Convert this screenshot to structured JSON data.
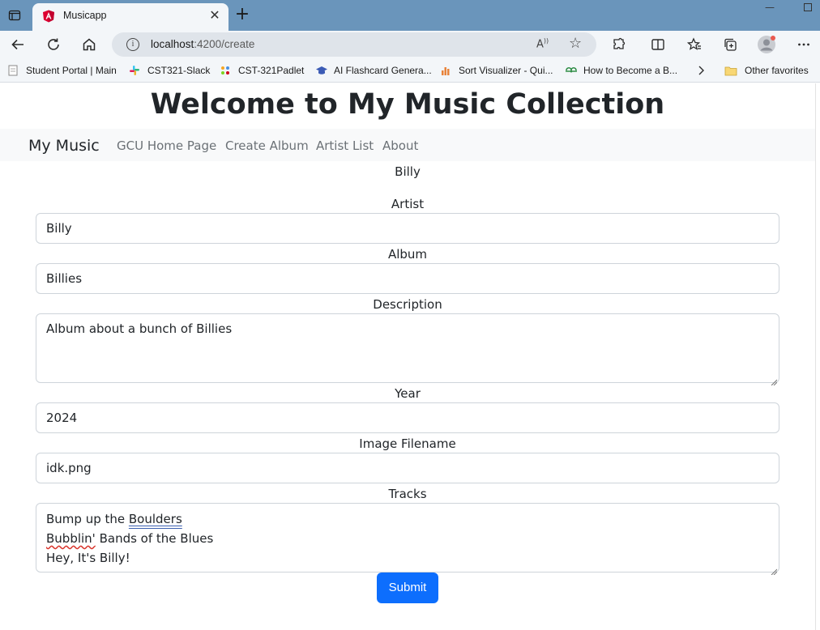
{
  "browser": {
    "tab_title": "Musicapp",
    "url_host": "localhost",
    "url_path": ":4200/create",
    "read_aloud_icon": "read-aloud-icon",
    "bookmarks": [
      {
        "label": "Student Portal | Main",
        "icon": "page-icon"
      },
      {
        "label": "CST321-Slack",
        "icon": "slack-icon"
      },
      {
        "label": "CST-321Padlet",
        "icon": "padlet-icon"
      },
      {
        "label": "AI Flashcard Genera...",
        "icon": "graduation-cap-icon"
      },
      {
        "label": "Sort Visualizer - Qui...",
        "icon": "bar-chart-icon"
      },
      {
        "label": "How to Become a B...",
        "icon": "gfg-icon"
      },
      {
        "label": "Other favorites",
        "icon": "folder-icon"
      }
    ]
  },
  "page": {
    "heading": "Welcome to My Music Collection",
    "nav": {
      "brand": "My Music",
      "links": [
        "GCU Home Page",
        "Create Album",
        "Artist List",
        "About"
      ]
    },
    "preview_artist": "Billy",
    "form": {
      "artist_label": "Artist",
      "artist_value": "Billy",
      "album_label": "Album",
      "album_value": "Billies",
      "description_label": "Description",
      "description_value": "Album about a bunch of Billies",
      "year_label": "Year",
      "year_value": "2024",
      "image_label": "Image Filename",
      "image_value": "idk.png",
      "tracks_label": "Tracks",
      "tracks": {
        "line1_prefix": "Bump up the ",
        "line1_word": "Boulders",
        "line2_word": "Bubblin'",
        "line2_rest": " Bands of the Blues",
        "line3": "Hey, It's Billy!"
      },
      "submit_label": "Submit"
    }
  },
  "colors": {
    "primary": "#0d6efd",
    "tabbar": "#6a95bb",
    "navbar_bg": "#f8f9fa"
  }
}
